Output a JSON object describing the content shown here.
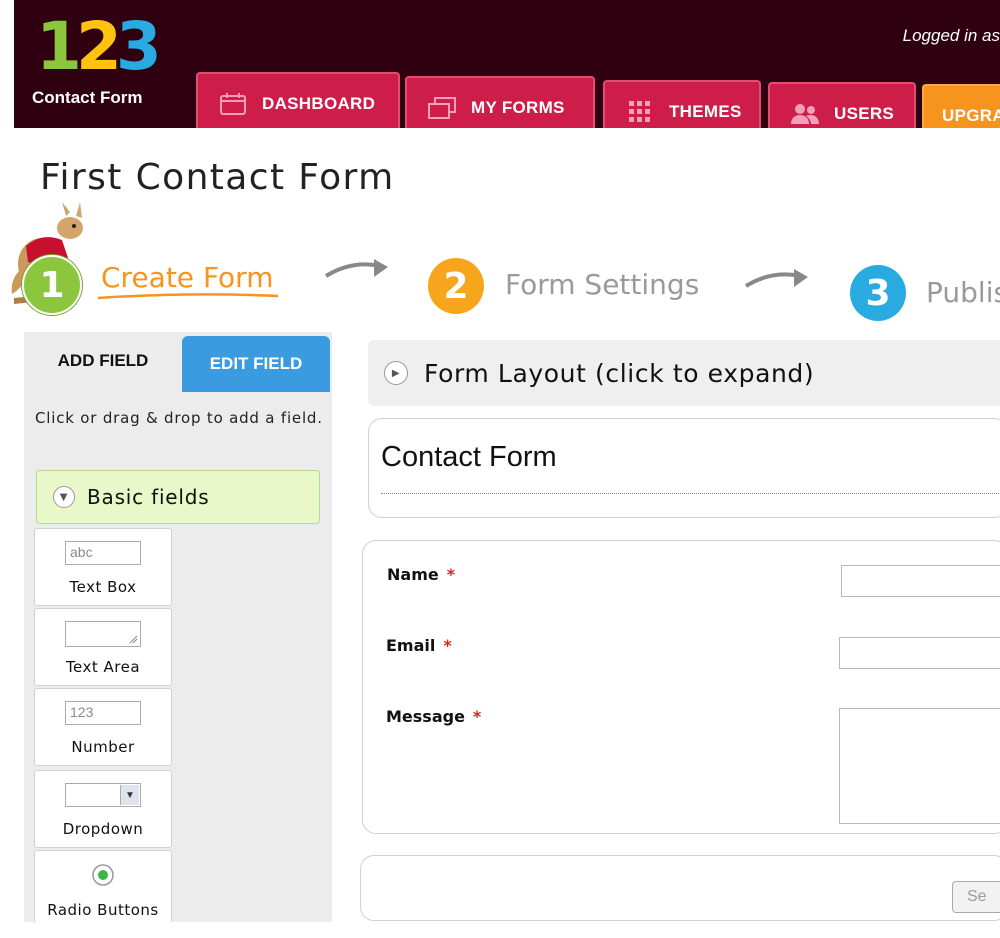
{
  "header": {
    "logo": {
      "digits": [
        "1",
        "2",
        "3"
      ],
      "text": "Contact Form"
    },
    "login_text": "Logged in as",
    "nav": [
      {
        "label": "DASHBOARD",
        "icon": "calendar-icon"
      },
      {
        "label": "MY FORMS",
        "icon": "forms-icon"
      },
      {
        "label": "THEMES",
        "icon": "grid-icon"
      },
      {
        "label": "USERS",
        "icon": "users-icon"
      },
      {
        "label": "UPGRADE",
        "icon": ""
      }
    ]
  },
  "page": {
    "title": "First Contact Form"
  },
  "steps": [
    {
      "number": "1",
      "label": "Create Form",
      "active": true,
      "color": "#8cc63f"
    },
    {
      "number": "2",
      "label": "Form Settings",
      "active": false,
      "color": "#f7a51c"
    },
    {
      "number": "3",
      "label": "Publish",
      "active": false,
      "color": "#29abe2"
    }
  ],
  "left_panel": {
    "tabs": {
      "add": "ADD FIELD",
      "edit": "EDIT FIELD"
    },
    "hint": "Click or drag & drop to add a field.",
    "group": "Basic fields",
    "fields": [
      {
        "label": "Text Box",
        "preview": "abc"
      },
      {
        "label": "Text Area",
        "preview": ""
      },
      {
        "label": "Number",
        "preview": "123"
      },
      {
        "label": "Dropdown",
        "preview": ""
      },
      {
        "label": "Radio Buttons",
        "preview": ""
      }
    ]
  },
  "form": {
    "layout_toggle": "Form Layout (click to expand)",
    "title": "Contact Form",
    "fields": [
      {
        "label": "Name",
        "required": "*"
      },
      {
        "label": "Email",
        "required": "*"
      },
      {
        "label": "Message",
        "required": "*"
      }
    ],
    "submit_label": "Se"
  },
  "colors": {
    "header_bg": "#2e0010",
    "nav_tab": "#cf1d4a",
    "upgrade_tab": "#f7941d",
    "active_step_text": "#f7941d",
    "edit_tab": "#3b9be0",
    "basic_fields_bg": "#e8f8c9"
  }
}
